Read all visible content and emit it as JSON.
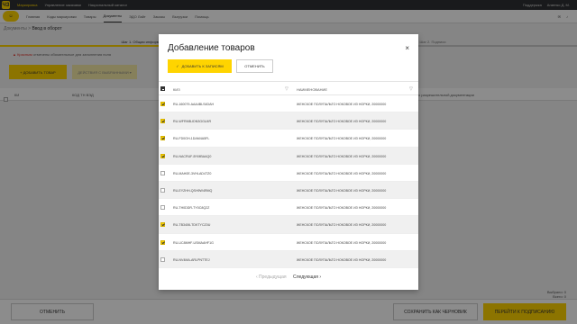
{
  "topbar": {
    "logo_glyph": "ЧЗ",
    "links": [
      "Маркировка",
      "Управление заказами",
      "Национальный каталог"
    ],
    "right_items": [
      "Поддержка",
      "Агаенко Д. М."
    ]
  },
  "navbar": {
    "brand_glyph": "☺",
    "items": [
      "Главная",
      "Коды маркировки",
      "Товары",
      "Документы",
      "ЭДО Лайт",
      "Заказы",
      "Выгрузки",
      "Помощь"
    ],
    "right_icons": [
      "mail-icon",
      "bell-icon"
    ]
  },
  "breadcrumb": {
    "root": "Документы",
    "sep": ">",
    "current": "Ввод в оборот"
  },
  "steps": [
    "Шаг 1. Общая информация",
    "Шаг 2. Подписи"
  ],
  "required_note": {
    "star": "Красным",
    "text": "отмечены обязательные для заполнения поля"
  },
  "bg_buttons": {
    "add": "+ ДОБАВИТЬ ТОВАР",
    "actions": "ДЕЙСТВИЯ С ВЫБРАННЫМИ ▾"
  },
  "bg_table": {
    "col1": "КИ",
    "col2": "КОД ТН ВЭД",
    "doc_note": "о разрешительной документации"
  },
  "bg_totals": {
    "selected": "Выбрано: 0",
    "total": "Всего: 0"
  },
  "footer": {
    "cancel": "ОТМЕНИТЬ",
    "save_draft": "СОХРАНИТЬ КАК ЧЕРНОВИК",
    "sign": "ПЕРЕЙТИ К ПОДПИСАНИЮ"
  },
  "modal": {
    "title": "Добавление товаров",
    "close": "×",
    "add_button": "ДОБАВИТЬ К ЗАПИСЯМ",
    "add_icon": "✓",
    "cancel_button": "ОТМЕНИТЬ",
    "columns": {
      "kiz": "КИЗ",
      "name": "НАИМЕНОВАНИЕ"
    },
    "filter_icon": "▽",
    "rows": [
      {
        "checked": true,
        "kiz": "RU-160079-AAA4BLS4DAH",
        "name": "ЖЕНСКОЕ ПОЛУПАЛЬТО НОКОВОЕ ИЗ НОРКИ, 20000000"
      },
      {
        "checked": true,
        "kiz": "RU-WFRMB-IDN3GGU4R",
        "name": "ЖЕНСКОЕ ПОЛУПАЛЬТО НОКОВОЕ ИЗ НОРКИ, 20000000"
      },
      {
        "checked": true,
        "kiz": "RU-FD0GH-1DAM4A5FL",
        "name": "ЖЕНСКОЕ ПОЛУПАЛЬТО НОКОВОЕ ИЗ НОРКИ, 20000000"
      },
      {
        "checked": true,
        "kiz": "RU-NACRUF-BYMBAAQ0",
        "name": "ЖЕНСКОЕ ПОЛУПАЛЬТО НОКОВОЕ ИЗ НОРКИ, 20000000"
      },
      {
        "checked": false,
        "kiz": "RU-MAH0E-3VHLAD4TZ0",
        "name": "ЖЕНСКОЕ ПОЛУПАЛЬТО НОКОВОЕ ИЗ НОРКИ, 20000000"
      },
      {
        "checked": false,
        "kiz": "RU-EYZHH-QSH9W4RMQ",
        "name": "ЖЕНСКОЕ ПОЛУПАЛЬТО НОКОВОЕ ИЗ НОРКИ, 20000000"
      },
      {
        "checked": false,
        "kiz": "RU-TH0DDR-TY0C8Q2Z",
        "name": "ЖЕНСКОЕ ПОЛУПАЛЬТО НОКОВОЕ ИЗ НОРКИ, 20000000"
      },
      {
        "checked": true,
        "kiz": "RU-TB3406-TDKTYCZ0U",
        "name": "ЖЕНСКОЕ ПОЛУПАЛЬТО НОКОВОЕ ИЗ НОРКИ, 20000000"
      },
      {
        "checked": true,
        "kiz": "RU-UC8MHF-USMAAHF1G",
        "name": "ЖЕНСКОЕ ПОЛУПАЛЬТО НОКОВОЕ ИЗ НОРКИ, 20000000"
      },
      {
        "checked": false,
        "kiz": "RU-NV4MA-ARLPNTTEJ",
        "name": "ЖЕНСКОЕ ПОЛУПАЛЬТО НОКОВОЕ ИЗ НОРКИ, 20000000"
      }
    ],
    "pager": {
      "prev": "‹  Предыдущая",
      "next": "Следующая  ›"
    }
  },
  "colors": {
    "accent": "#ffd400",
    "topbar": "#2f3133",
    "overlay": "rgba(0,0,0,0.45)"
  }
}
